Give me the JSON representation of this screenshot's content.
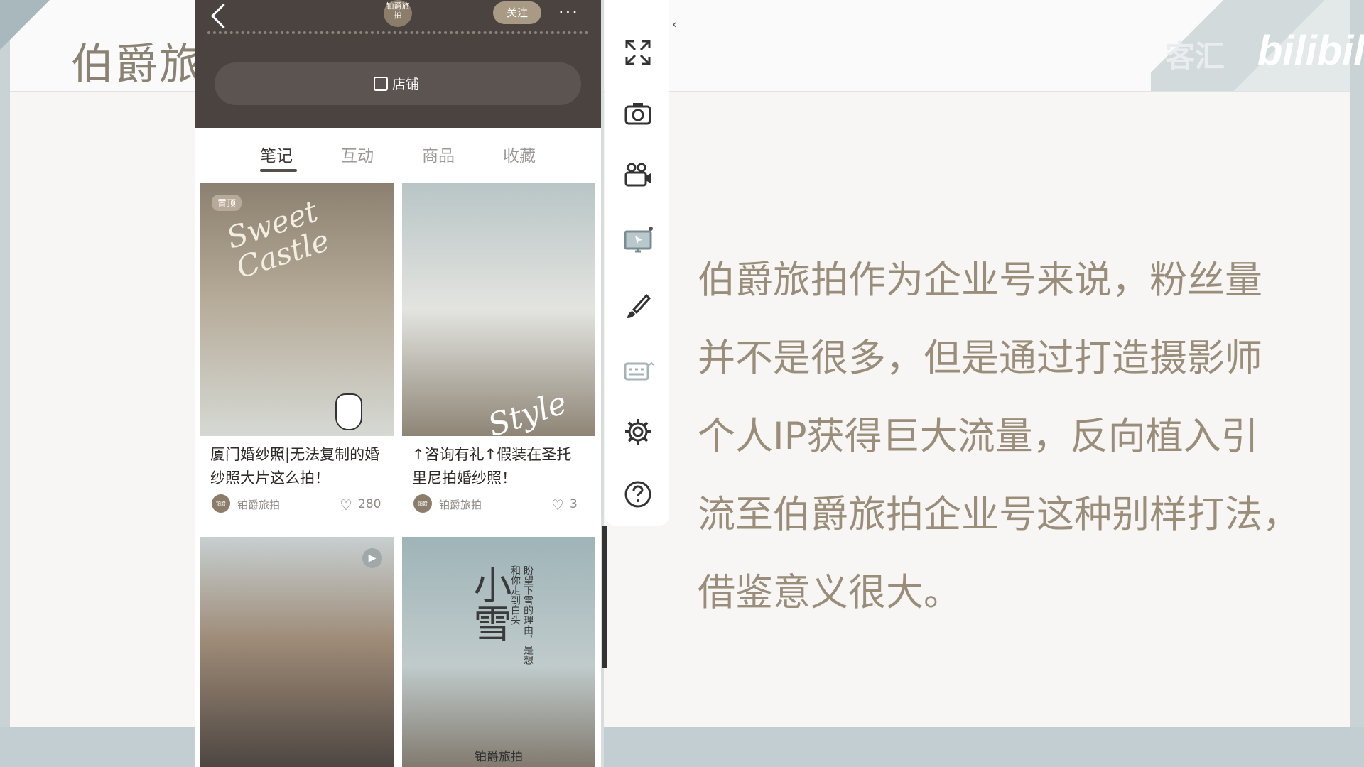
{
  "slide": {
    "title": "伯爵旅拍",
    "watermark": "客汇",
    "brand_mark": "bilibili",
    "body_lines": [
      "伯爵旅拍作为企业号来说，粉丝量",
      "并不是很多，但是通过打造摄影师",
      "个人IP获得巨大流量，反向植入引",
      "流至伯爵旅拍企业号这种别样打法，",
      "借鉴意义很大。"
    ]
  },
  "phone": {
    "header": {
      "avatar_text": "铂爵旅拍",
      "follow_label": "关注",
      "more_label": "···"
    },
    "shop_label": "店铺",
    "tabs": [
      "笔记",
      "互动",
      "商品",
      "收藏"
    ],
    "active_tab": "笔记",
    "cards": [
      {
        "title": "厦门婚纱照|无法复制的婚纱照大片这么拍！",
        "author": "铂爵旅拍",
        "likes": "280",
        "tag": "置顶",
        "script_text": "Sweet Castle",
        "image_tones": [
          "#8c8170",
          "#b5aa98",
          "#d6d9d4"
        ]
      },
      {
        "title": "↑咨询有礼↑假装在圣托里尼拍婚纱照！",
        "author": "铂爵旅拍",
        "likes": "3",
        "script_text": "Style",
        "image_tones": [
          "#b9c5c6",
          "#e3e4e0",
          "#8e8576"
        ]
      },
      {
        "title": "",
        "author": "",
        "likes": "",
        "image_tones": [
          "#c7cfd0",
          "#9d8a76",
          "#4b4440"
        ]
      },
      {
        "title": "",
        "author": "",
        "likes": "",
        "snow_title": "小雪",
        "snow_poem": "盼望下雪的理由，是想和你走到白头",
        "brand": "铂爵旅拍",
        "image_tones": [
          "#9fb4b8",
          "#c0cbcb",
          "#7f776c"
        ]
      }
    ]
  },
  "toolbar": {
    "tools": [
      "fullscreen-icon",
      "camera-icon",
      "video-camera-icon",
      "screen-share-icon",
      "brush-icon",
      "keyboard-icon",
      "settings-icon",
      "help-icon"
    ],
    "collapse_label": "‹"
  }
}
